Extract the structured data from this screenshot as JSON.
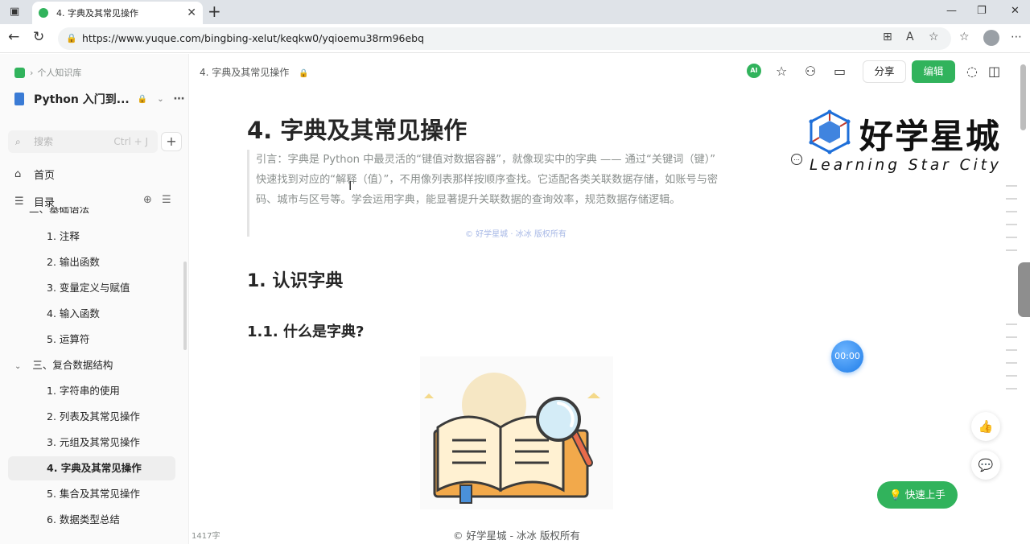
{
  "browser": {
    "tab_title": "4. 字典及其常见操作",
    "url": "https://www.yuque.com/bingbing-xelut/keqkw0/yqioemu38rm96ebq"
  },
  "sidebar": {
    "crumb": "个人知识库",
    "book_title": "Python 入门到...",
    "search_placeholder": "搜索",
    "search_shortcut": "Ctrl + J",
    "home_label": "首页",
    "toc_label": "目录",
    "partial_section": "二、基础语法",
    "items_section2": [
      "1. 注释",
      "2. 输出函数",
      "3. 变量定义与赋值",
      "4. 输入函数",
      "5. 运算符"
    ],
    "section3": "三、复合数据结构",
    "items_section3": [
      "1. 字符串的使用",
      "2. 列表及其常见操作",
      "3. 元组及其常见操作",
      "4. 字典及其常见操作",
      "5. 集合及其常见操作",
      "6. 数据类型总结"
    ]
  },
  "header": {
    "doc_crumb": "4. 字典及其常见操作",
    "ai_label": "AI",
    "share_label": "分享",
    "edit_label": "编辑"
  },
  "doc": {
    "title": "4. 字典及其常见操作",
    "quote_lines": [
      "引言：字典是 Python 中最灵活的“键值对数据容器”，就像现实中的字典 —— 通过“关键词（键）”",
      "快速找到对应的“解释（值）”，不用像列表那样按顺序查找。它适配各类关联数据存储，如账号与密",
      "码、城市与区号等。学会运用字典，能显著提升关联数据的查询效率，规范数据存储逻辑。"
    ],
    "inline_copyright": "© 好学星城 · 冰冰 版权所有",
    "h2": "1. 认识字典",
    "h3": "1.1. 什么是字典?"
  },
  "watermark": {
    "title": "好学星城",
    "subtitle": "Learning Star City"
  },
  "floating": {
    "timer": "00:00",
    "quickstart": "快速上手"
  },
  "footer": {
    "word_count": "1417字",
    "copyright": "© 好学星城 - 冰冰 版权所有"
  },
  "colors": {
    "brand_green": "#31b35c",
    "timer_blue": "#1e7ce8"
  }
}
